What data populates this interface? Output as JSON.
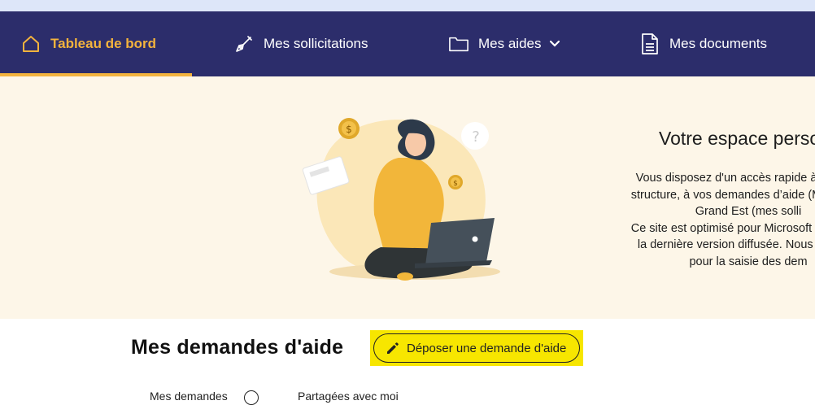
{
  "nav": {
    "items": [
      {
        "label": "Tableau de bord",
        "icon": "home-icon",
        "active": true
      },
      {
        "label": "Mes sollicitations",
        "icon": "pen-nib-icon",
        "active": false
      },
      {
        "label": "Mes aides",
        "icon": "folder-icon",
        "active": false,
        "has_dropdown": true
      },
      {
        "label": "Mes documents",
        "icon": "document-icon",
        "active": false
      }
    ]
  },
  "hero": {
    "title": "Votre espace perso",
    "lines": [
      "Vous disposez d'un accès rapide à vos info",
      "structure, à vos demandes d’aide (Mes aides",
      "Grand Est (mes solli",
      "Ce site est optimisé pour Microsoft Edge, Mo",
      "la dernière version diffusée. Nous recomm",
      "pour la saisie des dem"
    ]
  },
  "section": {
    "title": "Mes demandes d'aide",
    "deposit_button": "Déposer une demande d'aide",
    "tab_mine": "Mes demandes",
    "tab_shared": "Partagées avec moi"
  },
  "colors": {
    "nav_bg": "#2c2d6b",
    "accent": "#f3b33d",
    "hero_bg": "#fdf6e8",
    "highlight": "#f7e600"
  }
}
